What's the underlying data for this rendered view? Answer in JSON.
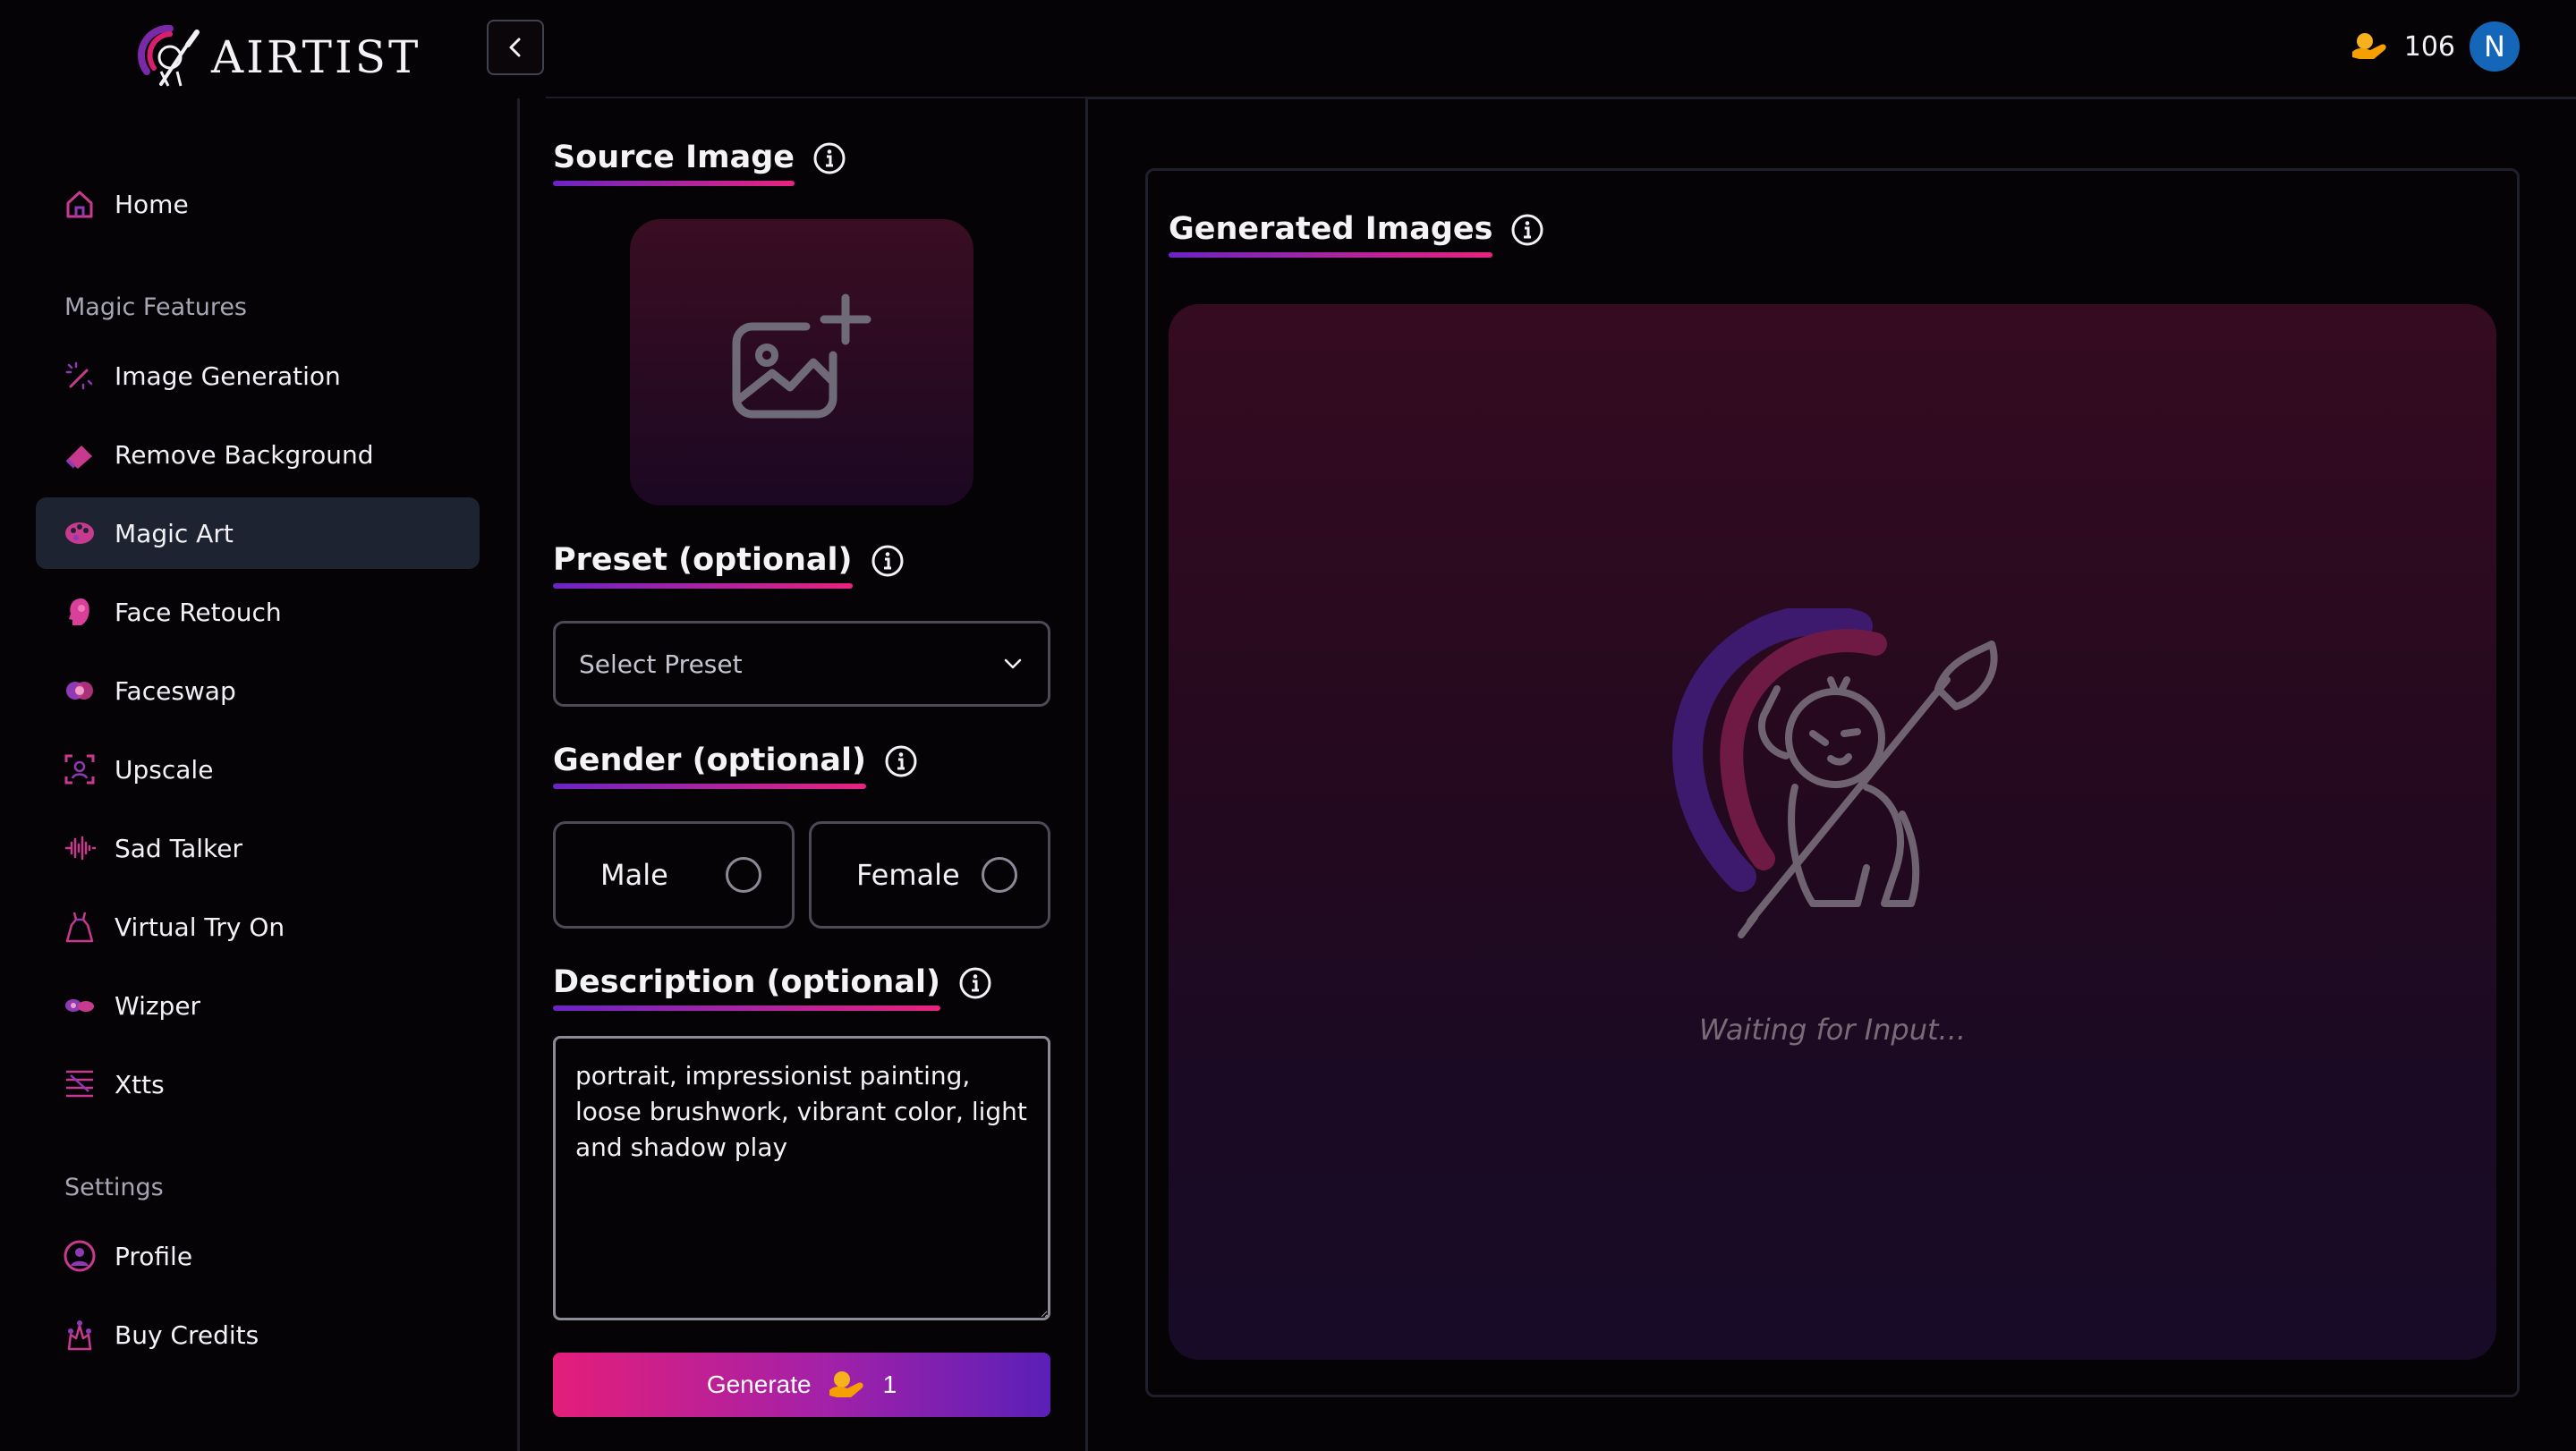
{
  "app": {
    "name": "AIRTIST"
  },
  "header": {
    "credits": "106",
    "avatar_initial": "N",
    "collapse_icon": "chevron-left-icon"
  },
  "sidebar": {
    "home": {
      "label": "Home",
      "icon": "home-icon"
    },
    "magic_features_label": "Magic Features",
    "items": [
      {
        "label": "Image Generation",
        "icon": "magic-wand-icon"
      },
      {
        "label": "Remove Background",
        "icon": "eraser-icon"
      },
      {
        "label": "Magic Art",
        "icon": "palette-icon",
        "active": true
      },
      {
        "label": "Face Retouch",
        "icon": "face-profile-icon"
      },
      {
        "label": "Faceswap",
        "icon": "faceswap-icon"
      },
      {
        "label": "Upscale",
        "icon": "upscale-icon"
      },
      {
        "label": "Sad Talker",
        "icon": "waveform-icon"
      },
      {
        "label": "Virtual Try On",
        "icon": "dress-icon"
      },
      {
        "label": "Wizper",
        "icon": "wizper-icon"
      },
      {
        "label": "Xtts",
        "icon": "lines-icon"
      }
    ],
    "settings_label": "Settings",
    "settings_items": [
      {
        "label": "Profile",
        "icon": "profile-icon"
      },
      {
        "label": "Buy Credits",
        "icon": "credits-icon"
      }
    ]
  },
  "form": {
    "source_image": {
      "title": "Source Image",
      "upload_icon": "image-add-icon"
    },
    "preset": {
      "title": "Preset (optional)",
      "placeholder": "Select Preset"
    },
    "gender": {
      "title": "Gender (optional)",
      "options": [
        "Male",
        "Female"
      ]
    },
    "description": {
      "title": "Description (optional)",
      "value": "portrait, impressionist painting, loose brushwork, vibrant color, light and shadow play"
    },
    "generate": {
      "label": "Generate",
      "cost": "1"
    }
  },
  "output": {
    "title": "Generated Images",
    "waiting_text": "Waiting for Input..."
  },
  "colors": {
    "accent_pink": "#e41e7a",
    "accent_purple": "#5b1fb8",
    "active_nav_bg": "#1e2331",
    "avatar_bg": "#1467b8"
  }
}
